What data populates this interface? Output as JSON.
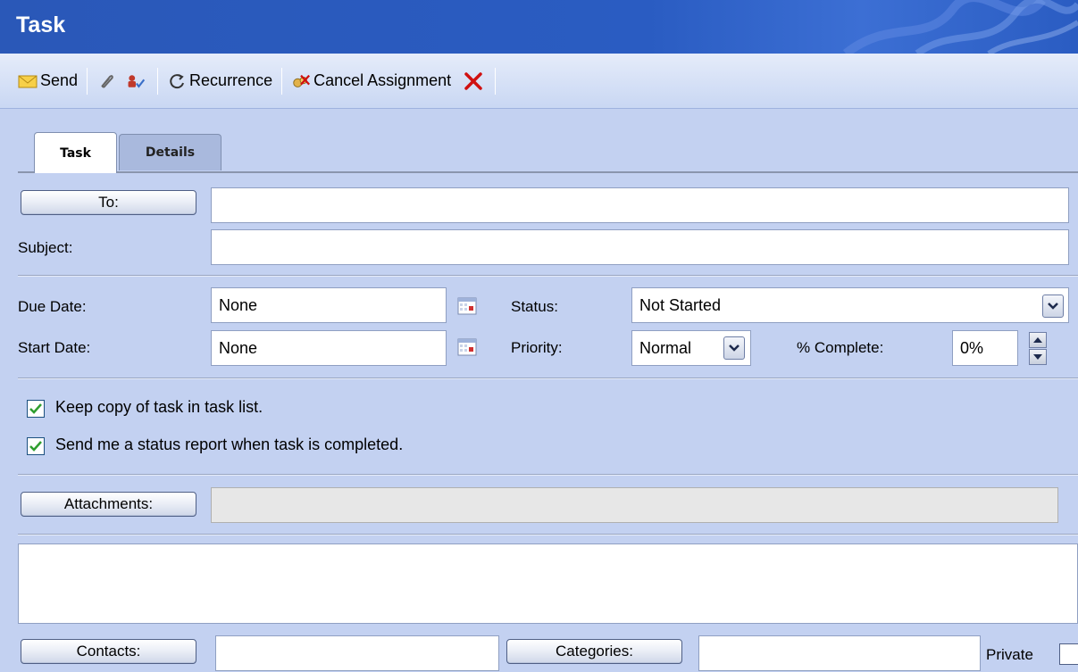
{
  "window": {
    "title": "Task"
  },
  "toolbar": {
    "send_label": "Send",
    "recurrence_label": "Recurrence",
    "cancel_assignment_label": "Cancel Assignment"
  },
  "tabs": [
    {
      "label": "Task",
      "active": true
    },
    {
      "label": "Details",
      "active": false
    }
  ],
  "form": {
    "to_button": "To:",
    "to_value": "",
    "subject_label": "Subject:",
    "subject_value": "",
    "due_date_label": "Due Date:",
    "due_date_value": "None",
    "start_date_label": "Start Date:",
    "start_date_value": "None",
    "status_label": "Status:",
    "status_value": "Not Started",
    "priority_label": "Priority:",
    "priority_value": "Normal",
    "complete_label": "% Complete:",
    "complete_value": "0%",
    "keep_copy_label": "Keep copy of task in task list.",
    "keep_copy_checked": true,
    "status_report_label": "Send me a status report when task is completed.",
    "status_report_checked": true,
    "attachments_button": "Attachments:",
    "attachments_value": "",
    "body_value": "",
    "contacts_button": "Contacts:",
    "contacts_value": "",
    "categories_button": "Categories:",
    "categories_value": "",
    "private_label": "Private",
    "private_checked": false
  },
  "colors": {
    "titlebar": "#2a5cc2",
    "background": "#c3d1f1",
    "checkbox_check": "#2f9e2f",
    "delete_x": "#d01010"
  }
}
